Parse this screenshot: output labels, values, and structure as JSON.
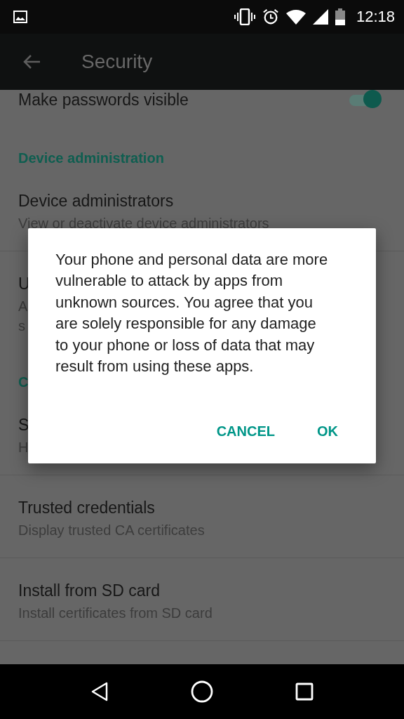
{
  "status_bar": {
    "time": "12:18"
  },
  "app_bar": {
    "title": "Security"
  },
  "settings": [
    {
      "kind": "switch",
      "title": "Make passwords visible",
      "on": true
    },
    {
      "kind": "category",
      "title": "Device administration"
    },
    {
      "kind": "item",
      "title": "Device administrators",
      "summary_lines": [
        "View or deactivate device administrators"
      ],
      "divider": true
    },
    {
      "kind": "item",
      "title": "U",
      "summary_lines": [
        "A",
        "s"
      ],
      "divider": false
    },
    {
      "kind": "category",
      "title": "C"
    },
    {
      "kind": "item",
      "title": "S",
      "summary_lines": [
        "H"
      ],
      "divider": true
    },
    {
      "kind": "item",
      "title": "Trusted credentials",
      "summary_lines": [
        "Display trusted CA certificates"
      ],
      "divider": true
    },
    {
      "kind": "item",
      "title": "Install from SD card",
      "summary_lines": [
        "Install certificates from SD card"
      ],
      "divider": true
    }
  ],
  "dialog": {
    "message": "Your phone and personal data are more vulnerable to attack by apps from unknown sources. You agree that you are solely responsible for any damage to your phone or loss of data that may result from using these apps.",
    "buttons": [
      "CANCEL",
      "OK"
    ]
  }
}
